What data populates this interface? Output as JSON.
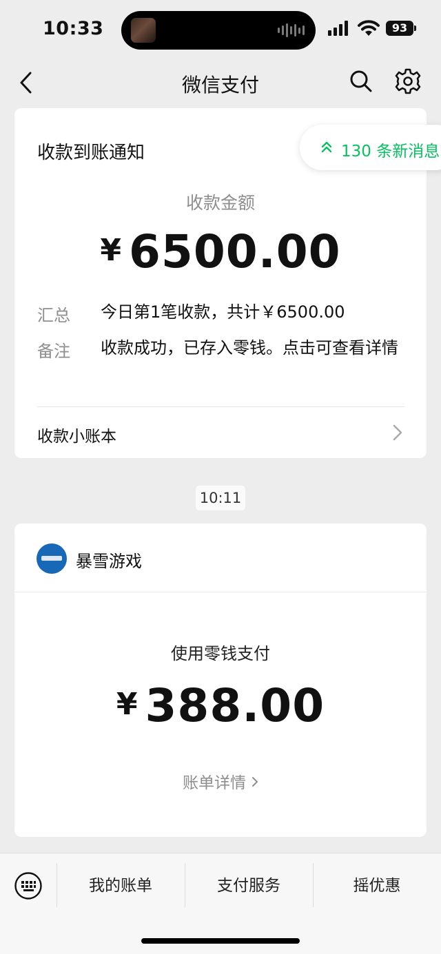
{
  "status_bar": {
    "time": "10:33",
    "battery": "93"
  },
  "nav": {
    "title": "微信支付",
    "back_icon": "back-chevron",
    "search_icon": "search",
    "settings_icon": "gear"
  },
  "notice_card": {
    "title": "收款到账通知",
    "amount_label": "收款金额",
    "currency": "¥",
    "amount": "6500.00",
    "rows": [
      {
        "label": "汇总",
        "value": "今日第1笔收款，共计￥6500.00"
      },
      {
        "label": "备注",
        "value": "收款成功，已存入零钱。点击可查看详情"
      }
    ],
    "ledger_link": "收款小账本"
  },
  "new_messages": {
    "text": "130 条新消息",
    "color": "#07c160"
  },
  "timestamp": "10:11",
  "payment_card": {
    "merchant": "暴雪游戏",
    "label": "使用零钱支付",
    "currency": "¥",
    "amount": "388.00",
    "detail_link": "账单详情"
  },
  "bottom_tabs": [
    "我的账单",
    "支付服务",
    "摇优惠"
  ]
}
